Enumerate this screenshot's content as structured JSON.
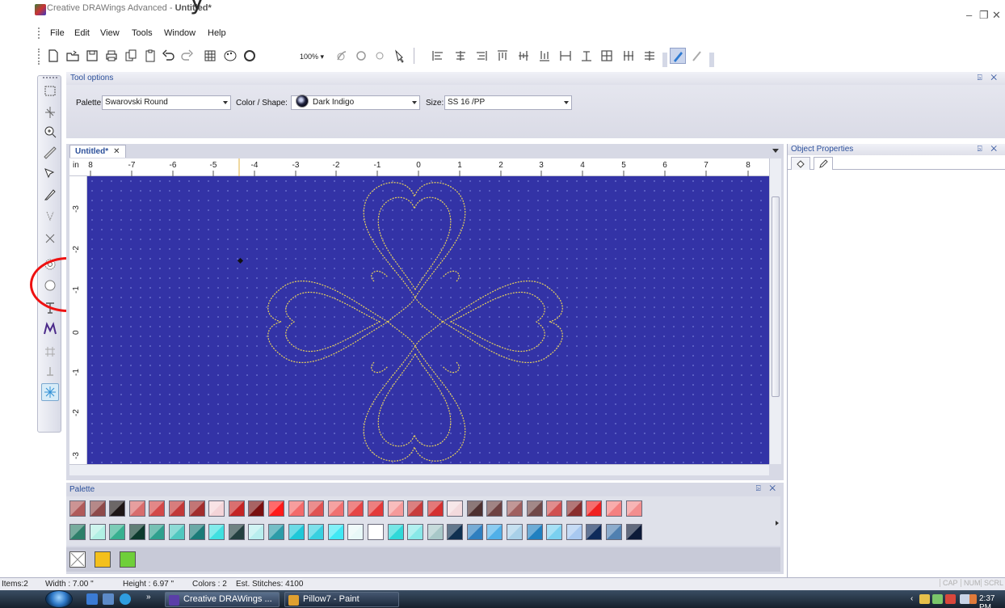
{
  "window": {
    "app_name": "Creative DRAWings Advanced",
    "separator": " - ",
    "doc_name": "Untitled*",
    "overlay_glyph": "y",
    "controls": {
      "minimize": "–",
      "maximize": "❐",
      "close": "✕"
    }
  },
  "menu": {
    "items": [
      "File",
      "Edit",
      "View",
      "Tools",
      "Window",
      "Help"
    ]
  },
  "toolbar": {
    "zoom": "100% ▾",
    "icons": [
      "new-file-icon",
      "open-folder-icon",
      "save-icon",
      "print-icon",
      "copy-icon",
      "paste-icon",
      "undo-icon",
      "redo-icon",
      "grid-icon",
      "palette-icon",
      "stitch-icon",
      "zoom-in-icon",
      "zoom-out-icon",
      "zoom-fit-icon",
      "help-icon",
      "align-left-icon",
      "align-center-icon",
      "align-right-icon",
      "align-top-icon",
      "align-middle-icon",
      "align-bottom-icon",
      "distribute-h-icon",
      "distribute-v-icon",
      "table-icon",
      "group-icon",
      "ungroup-icon",
      "brush-icon",
      "magic-wand-icon"
    ]
  },
  "tool_options": {
    "title": "Tool options",
    "pin": "⍄ ✕",
    "palette_label": "Palette:",
    "palette_value": "Swarovski Round",
    "color_label": "Color / Shape:",
    "color_value": "Dark Indigo",
    "color_swatch": "#1a1c3a",
    "size_label": "Size:",
    "size_value": "SS 16 /PP"
  },
  "document": {
    "tab_label": "Untitled*",
    "tab_close": "✕",
    "canvas_color": "#3333a6",
    "stitch_color": "#e8d25a",
    "ruler": {
      "unit": "in",
      "top_ticks": [
        "8",
        "-7",
        "-6",
        "-5",
        "-4",
        "-3",
        "-2",
        "-1",
        "0",
        "1",
        "2",
        "3",
        "4",
        "5",
        "6",
        "7",
        "8"
      ],
      "left_ticks": [
        "-3",
        "-2",
        "-1",
        "0",
        "-1",
        "-2",
        "-3"
      ]
    }
  },
  "object_properties": {
    "title": "Object Properties",
    "pin": "⍄ ✕",
    "tabs": [
      "fill-bucket-icon",
      "pencil-icon"
    ]
  },
  "palette": {
    "title": "Palette",
    "pin": "⍄ ✕",
    "row1": [
      "#b05a5a",
      "#8e4a4a",
      "#1e1616",
      "#d86c6c",
      "#d34848",
      "#c23838",
      "#a22d2d",
      "#f4d4d8",
      "#c42424",
      "#7a0f0f",
      "#ff1a1a",
      "#f36a6a",
      "#e05252",
      "#f07070",
      "#e64545",
      "#e33a3a",
      "#f59a9a",
      "#c83c3c",
      "#d43030",
      "#f3dadd",
      "#4e3030",
      "#6e4242",
      "#a06060",
      "#704848",
      "#d05050",
      "#8a2e2e",
      "#f02020",
      "#f58080",
      "#f28e8e"
    ],
    "row2": [
      "#2e7f6a",
      "#b2f0e4",
      "#38b090",
      "#0d3a2e",
      "#2fa08e",
      "#50c8c0",
      "#1b7b78",
      "#40e0e0",
      "#244040",
      "#b8eeee",
      "#2c9ca8",
      "#1fc8d8",
      "#38d0e0",
      "#40e8f4",
      "#e8f8f8",
      "#ffffff",
      "#30d8d8",
      "#88e8e8",
      "#a8c8c8",
      "#103050",
      "#2f7fbf",
      "#50b0e8",
      "#a8d0e8",
      "#2080c0",
      "#7ad0f0",
      "#a8c8f0",
      "#0e2a5a",
      "#5080b0",
      "#0c1a38"
    ],
    "used": [
      {
        "name": "none",
        "color": "#ffffff"
      },
      {
        "name": "gold",
        "color": "#f4c01c"
      },
      {
        "name": "green",
        "color": "#6fcf3a"
      }
    ]
  },
  "status": {
    "items": "Items:2",
    "width": "Width : 7.00 \"",
    "height": "Height : 6.97 \"",
    "colors": "Colors : 2",
    "stitches": "Est. Stitches: 4100",
    "indicators": [
      "CAP",
      "NUM",
      "SCRL"
    ]
  },
  "taskbar": {
    "more": "»",
    "tasks": [
      {
        "label": "Creative DRAWings ...",
        "color": "#5a3ea8"
      },
      {
        "label": "Pillow7 - Paint",
        "color": "#e0a030"
      }
    ],
    "tray_arrow": "‹",
    "clock": "2:37 PM"
  }
}
